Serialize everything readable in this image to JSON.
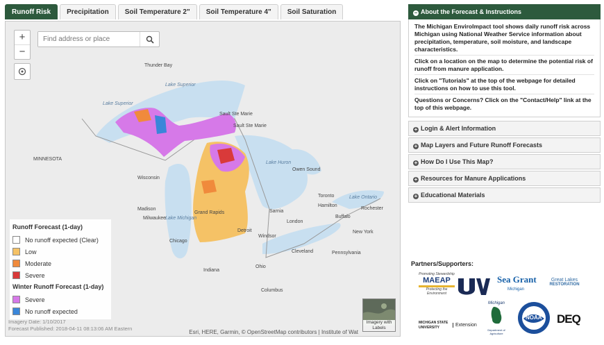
{
  "tabs": [
    "Runoff Risk",
    "Precipitation",
    "Soil Temperature 2\"",
    "Soil Temperature 4\"",
    "Soil Saturation"
  ],
  "search": {
    "placeholder": "Find address or place"
  },
  "zoom": {
    "in": "+",
    "out": "−"
  },
  "map_labels": {
    "lake_superior": "Lake Superior",
    "lake_superior_2": "Lake Superior",
    "lake_michigan": "Lake Michigan",
    "lake_huron": "Lake Huron",
    "lake_ontario": "Lake Ontario",
    "thunder_bay": "Thunder Bay",
    "sault_ste_marie": "Sault Ste Marie",
    "sault_ste_marie_2": "Sault Ste Marie",
    "minnesota": "MINNESOTA",
    "wisconsin": "Wisconsin",
    "madison": "Madison",
    "milwaukee": "Milwaukee",
    "chicago": "Chicago",
    "grand_rapids": "Grand Rapids",
    "detroit": "Detroit",
    "windsor": "Windsor",
    "cleveland": "Cleveland",
    "columbus": "Columbus",
    "toronto": "Toronto",
    "hamilton": "Hamilton",
    "rochester": "Rochester",
    "buffalo": "Buffalo",
    "owen_sound": "Owen Sound",
    "sarnia": "Sarnia",
    "london": "London",
    "ohio": "Ohio",
    "indiana": "Indiana",
    "pennsylvania": "Pennsylvania",
    "new_york": "New York"
  },
  "legend": {
    "title": "Runoff Forecast (1-day)",
    "items": [
      {
        "label": "No runoff expected (Clear)",
        "color": "#ffffff"
      },
      {
        "label": "Low",
        "color": "#f5c266"
      },
      {
        "label": "Moderate",
        "color": "#f08a3c"
      },
      {
        "label": "Severe",
        "color": "#d93a3a"
      }
    ],
    "winter_title": "Winter Runoff Forecast (1-day)",
    "winter_items": [
      {
        "label": "Severe",
        "color": "#d679e8"
      },
      {
        "label": "No runoff expected",
        "color": "#3a86d9"
      }
    ]
  },
  "stamp": [
    "Imagery Date: 1/10/2017",
    "Forecast Published: 2018-04-11 08:13:06 AM Eastern"
  ],
  "imagery_label": "Imagery with Labels",
  "credit": "Esri, HERE, Garmin, © OpenStreetMap contributors | Institute of Wat",
  "sidebar": {
    "open_title": "About the Forecast & Instructions",
    "paragraphs": [
      "The Michigan EnviroImpact tool shows daily runoff risk across Michigan using National Weather Service information about precipitation, temperature, soil moisture, and landscape characteristics.",
      "Click on a location on the map to determine the potential risk of runoff from manure application.",
      "Click on \"Tutorials\" at the top of the webpage for detailed instructions on how to use this tool.",
      "Questions or Concerns? Click on the \"Contact/Help\" link at the top of this webpage."
    ],
    "sections": [
      "Login & Alert Information",
      "Map Layers and Future Runoff Forecasts",
      "How Do I Use This Map?",
      "Resources for Manure Applications",
      "Educational Materials"
    ]
  },
  "partners": {
    "title": "Partners/Supporters:",
    "maeap": "MAEAP",
    "maeap_top": "Promoting Stewardship",
    "maeap_bottom": "Protecting the Environment",
    "seagrant": "Sea Grant",
    "seagrant_sub": "Michigan",
    "glr": "Great Lakes",
    "glr_sub": "RESTORATION",
    "msu": "MICHIGAN STATE UNIVERSITY",
    "extension": "Extension",
    "mda_top": "Michigan",
    "mda": "Department of Agriculture",
    "noaa": "NOAA",
    "deq": "DEQ"
  }
}
